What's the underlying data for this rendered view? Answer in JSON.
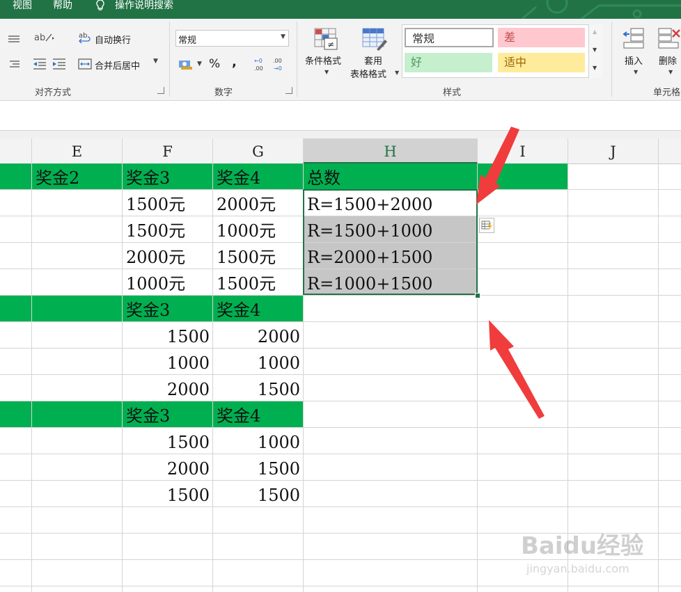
{
  "menu": {
    "view": "视图",
    "help": "帮助",
    "tell_me": "操作说明搜索"
  },
  "ribbon": {
    "alignment": {
      "wrap_text": "自动换行",
      "merge_center": "合并后居中",
      "group_label": "对齐方式"
    },
    "number": {
      "format_value": "常规",
      "percent": "%",
      "comma": ",",
      "group_label": "数字"
    },
    "styles": {
      "conditional_format": "条件格式",
      "format_as_table_1": "套用",
      "format_as_table_2": "表格格式",
      "group_label": "样式",
      "normal": "常规",
      "bad": "差",
      "good": "好",
      "neutral": "适中"
    },
    "cells": {
      "insert": "插入",
      "delete": "删除",
      "group_label": "单元格"
    }
  },
  "columns": [
    "E",
    "F",
    "G",
    "H",
    "I",
    "J"
  ],
  "table1": {
    "headers": [
      "奖金2",
      "奖金3",
      "奖金4",
      "总数"
    ],
    "rows": [
      [
        "1500元",
        "2000元",
        "R=1500+2000"
      ],
      [
        "1500元",
        "1000元",
        "R=1500+1000"
      ],
      [
        "2000元",
        "1500元",
        "R=2000+1500"
      ],
      [
        "1000元",
        "1500元",
        "R=1000+1500"
      ]
    ]
  },
  "table2": {
    "headers": [
      "奖金3",
      "奖金4"
    ],
    "rows": [
      [
        "1500",
        "2000"
      ],
      [
        "1000",
        "1000"
      ],
      [
        "2000",
        "1500"
      ]
    ]
  },
  "table3": {
    "headers": [
      "奖金3",
      "奖金4"
    ],
    "rows": [
      [
        "1500",
        "1000"
      ],
      [
        "2000",
        "1500"
      ],
      [
        "1500",
        "1500"
      ]
    ]
  },
  "colors": {
    "excel_green": "#217346",
    "header_fill": "#00b050",
    "selection": "#c6c6c6",
    "arrow": "#f03c3c"
  },
  "watermark": {
    "brand": "Baidu经验",
    "url": "jingyan.baidu.com"
  }
}
